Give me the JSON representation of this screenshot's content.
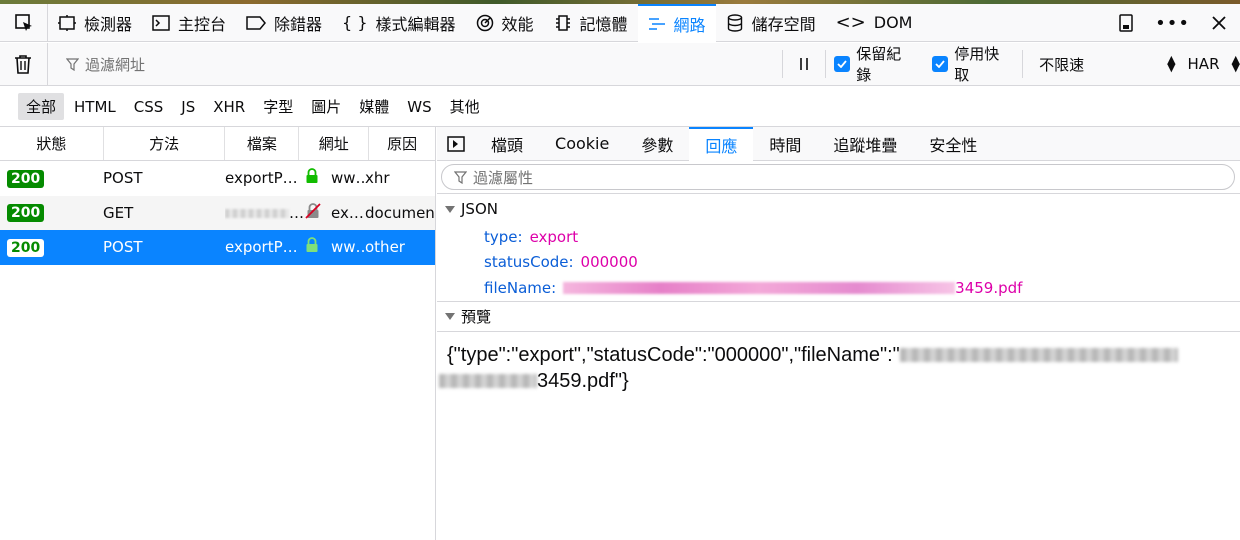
{
  "toolbar": {
    "tabs": [
      {
        "label": "檢測器",
        "icon": "inspector-icon"
      },
      {
        "label": "主控台",
        "icon": "console-icon"
      },
      {
        "label": "除錯器",
        "icon": "debugger-icon"
      },
      {
        "label": "樣式編輯器",
        "icon": "style-editor-icon"
      },
      {
        "label": "效能",
        "icon": "performance-icon"
      },
      {
        "label": "記憶體",
        "icon": "memory-icon"
      },
      {
        "label": "網路",
        "icon": "network-icon"
      },
      {
        "label": "儲存空間",
        "icon": "storage-icon"
      },
      {
        "label": "DOM",
        "icon": "dom-icon"
      }
    ],
    "active_tab": "網路"
  },
  "filter_bar": {
    "url_filter_placeholder": "過濾網址",
    "persist_logs_label": "保留紀錄",
    "disable_cache_label": "停用快取",
    "throttle_value": "不限速",
    "har_label": "HAR"
  },
  "type_filters": [
    "全部",
    "HTML",
    "CSS",
    "JS",
    "XHR",
    "字型",
    "圖片",
    "媒體",
    "WS",
    "其他"
  ],
  "request_table": {
    "headers": [
      "狀態",
      "方法",
      "檔案",
      "網址",
      "原因"
    ],
    "rows": [
      {
        "status": "200",
        "method": "POST",
        "file": "exportP…",
        "domain": "ww…",
        "cause": "xhr"
      },
      {
        "status": "200",
        "method": "GET",
        "file": "…",
        "domain": "ex…",
        "cause": "documen"
      },
      {
        "status": "200",
        "method": "POST",
        "file": "exportP…",
        "domain": "ww…",
        "cause": "other"
      }
    ]
  },
  "details": {
    "tabs": [
      "檔頭",
      "Cookie",
      "參數",
      "回應",
      "時間",
      "追蹤堆疊",
      "安全性"
    ],
    "active_tab": "回應",
    "prop_filter_placeholder": "過濾屬性",
    "json_section_label": "JSON",
    "json": {
      "type_key": "type:",
      "type_value": "export",
      "status_key": "statusCode:",
      "status_value": "000000",
      "file_key": "fileName:",
      "file_value_suffix": "3459.pdf"
    },
    "preview_section_label": "預覽",
    "preview_line1": "{\"type\":\"export\",\"statusCode\":\"000000\",\"fileName\":\"",
    "preview_line2_suffix": "3459.pdf\"}"
  },
  "colors": {
    "accent": "#0a84ff",
    "status_ok": "#058b00",
    "json_key": "#0b5ed7",
    "json_value": "#dd00a9"
  }
}
